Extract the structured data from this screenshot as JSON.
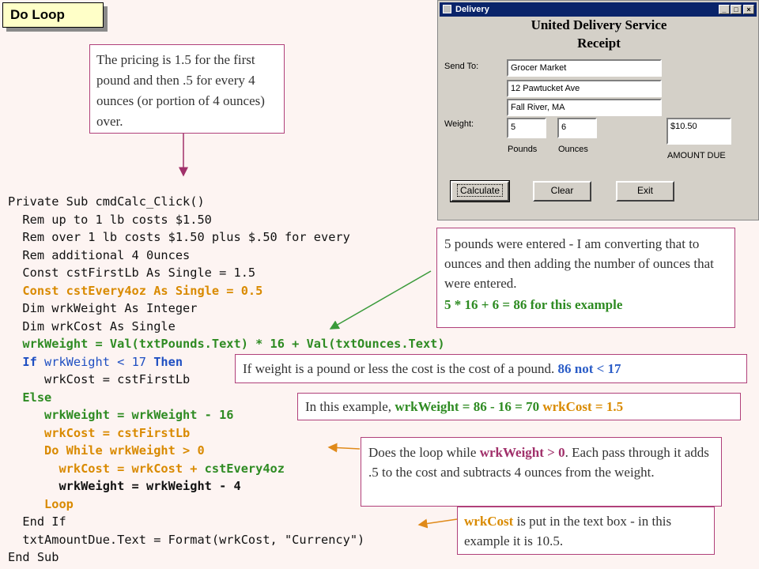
{
  "slide_title": "Do Loop",
  "note_pricing": "The pricing is 1.5 for the first pound and then .5 for every 4 ounces (or portion of 4 ounces) over.",
  "note_convert": {
    "text": "5 pounds were entered - I am converting that to ounces and then adding the number of ounces that were entered.",
    "example": "5 * 16 + 6 = 86 for this example"
  },
  "note_if": {
    "text": "If weight is a pound or less the cost is the cost of a pound.",
    "highlight": "86 not < 17"
  },
  "note_else": {
    "prefix": "In this example,",
    "weight_part": "wrkWeight = 86 - 16 = 70",
    "cost_part": "wrkCost = 1.5"
  },
  "note_loop": {
    "t1": "Does the loop while",
    "cond": "wrkWeight > 0",
    "t2": ". Each pass through it adds .5 to the cost and subtracts 4 ounces from the weight."
  },
  "note_result": {
    "var": "wrkCost",
    "text": "is put in the text box - in this example it is 10.5."
  },
  "code": {
    "l1": "Private Sub cmdCalc_Click()",
    "l2": "  Rem up to 1 lb costs $1.50",
    "l3": "  Rem over 1 lb costs $1.50 plus $.50 for every",
    "l4": "  Rem additional 4 0unces",
    "l5": "  Const cstFirstLb As Single = 1.5",
    "l6": "  Const cstEvery4oz As Single = 0.5",
    "l7": "  Dim wrkWeight As Integer",
    "l8": "  Dim wrkCost As Single",
    "l9": "  wrkWeight = Val(txtPounds.Text) * 16 + Val(txtOunces.Text)",
    "l10a": "  If",
    "l10b": " wrkWeight < 17 ",
    "l10c": "Then",
    "l11": "     wrkCost = cstFirstLb",
    "l12": "  Else",
    "l13": "     wrkWeight = wrkWeight - 16",
    "l14": "     wrkCost = cstFirstLb",
    "l15": "     Do While wrkWeight > 0",
    "l16a": "       wrkCost = wrkCost + ",
    "l16b": "cstEvery4oz",
    "l17": "       wrkWeight = wrkWeight - 4",
    "l18": "     Loop",
    "l19": "  End If",
    "l20": "  txtAmountDue.Text = Format(wrkCost, \"Currency\")",
    "l21": "End Sub"
  },
  "window": {
    "title": "Delivery",
    "heading1": "United Delivery Service",
    "heading2": "Receipt",
    "send_to_label": "Send To:",
    "send_to_lines": [
      "Grocer Market",
      "12 Pawtucket Ave",
      "Fall River, MA"
    ],
    "weight_label": "Weight:",
    "pounds_value": "5",
    "ounces_value": "6",
    "pounds_label": "Pounds",
    "ounces_label": "Ounces",
    "amount_value": "$10.50",
    "amount_label": "AMOUNT DUE",
    "buttons": {
      "calculate": "Calculate",
      "clear": "Clear",
      "exit": "Exit"
    }
  },
  "colors": {
    "background": "#fdf4f2",
    "note_border": "#b0407a",
    "arrow_green": "#3a9a3a",
    "arrow_orange": "#e08a1a",
    "code_green": "#2e8b22",
    "code_blue": "#1f4fc2",
    "code_orange": "#d98a00",
    "titlebar": "#0a246a"
  }
}
